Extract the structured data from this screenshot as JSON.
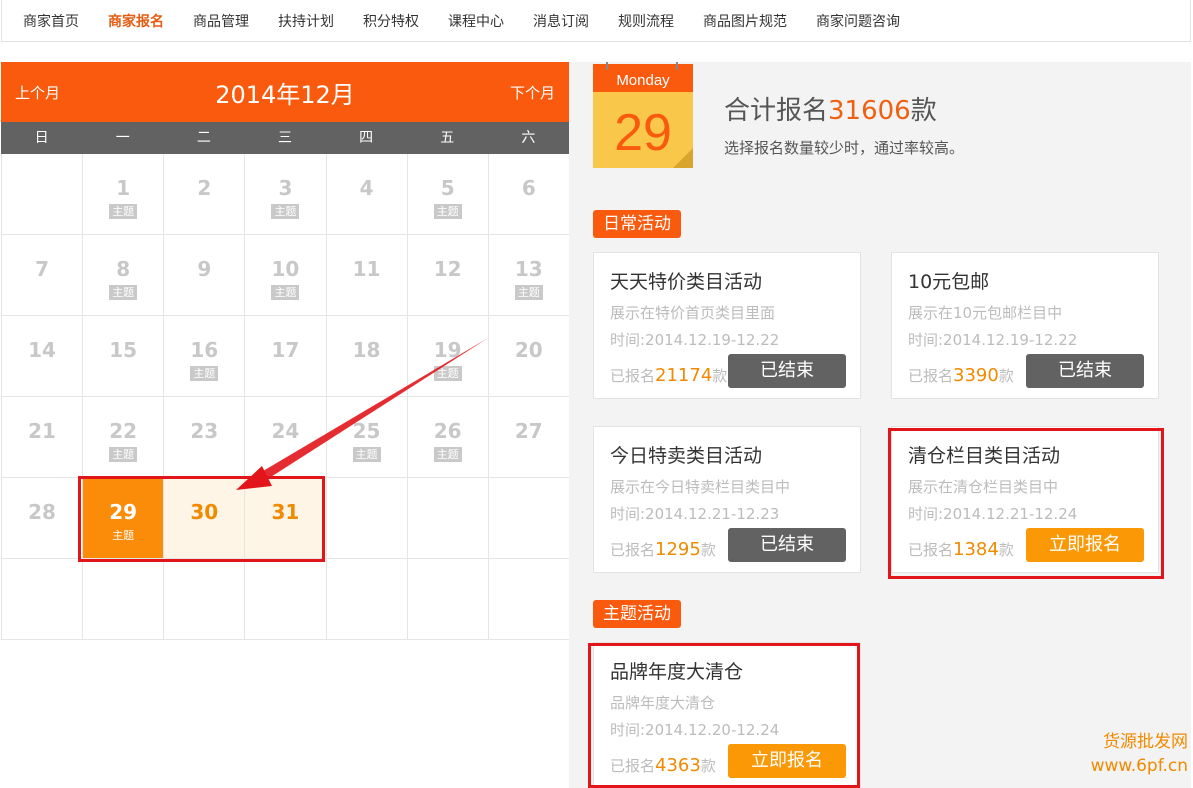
{
  "nav": [
    "商家首页",
    "商家报名",
    "商品管理",
    "扶持计划",
    "积分特权",
    "课程中心",
    "消息订阅",
    "规则流程",
    "商品图片规范",
    "商家问题咨询"
  ],
  "nav_active_index": 1,
  "calendar": {
    "prev_label": "上个月",
    "next_label": "下个月",
    "title": "2014年12月",
    "weekdays": [
      "日",
      "一",
      "二",
      "三",
      "四",
      "五",
      "六"
    ],
    "theme_label": "主题",
    "days": [
      {
        "d": ""
      },
      {
        "d": "1",
        "tag": true
      },
      {
        "d": "2"
      },
      {
        "d": "3",
        "tag": true
      },
      {
        "d": "4"
      },
      {
        "d": "5",
        "tag": true
      },
      {
        "d": "6"
      },
      {
        "d": "7"
      },
      {
        "d": "8",
        "tag": true
      },
      {
        "d": "9"
      },
      {
        "d": "10",
        "tag": true
      },
      {
        "d": "11"
      },
      {
        "d": "12"
      },
      {
        "d": "13",
        "tag": true
      },
      {
        "d": "14"
      },
      {
        "d": "15"
      },
      {
        "d": "16",
        "tag": true
      },
      {
        "d": "17"
      },
      {
        "d": "18"
      },
      {
        "d": "19",
        "tag": true
      },
      {
        "d": "20"
      },
      {
        "d": "21"
      },
      {
        "d": "22",
        "tag": true
      },
      {
        "d": "23"
      },
      {
        "d": "24"
      },
      {
        "d": "25",
        "tag": true
      },
      {
        "d": "26",
        "tag": true
      },
      {
        "d": "27"
      },
      {
        "d": "28"
      },
      {
        "d": "29",
        "tag": true,
        "state": "sel"
      },
      {
        "d": "30",
        "state": "soon"
      },
      {
        "d": "31",
        "state": "soon"
      },
      {
        "d": ""
      },
      {
        "d": ""
      },
      {
        "d": ""
      },
      {
        "d": ""
      },
      {
        "d": ""
      },
      {
        "d": ""
      },
      {
        "d": ""
      },
      {
        "d": ""
      },
      {
        "d": ""
      },
      {
        "d": ""
      }
    ]
  },
  "today_icon": {
    "weekday": "Monday",
    "day": "29"
  },
  "summary": {
    "prefix": "合计报名",
    "count": "31606",
    "suffix": "款",
    "hint": "选择报名数量较少时，通过率较高。"
  },
  "daily_section_label": "日常活动",
  "theme_section_label": "主题活动",
  "signed_prefix": "已报名",
  "signed_suffix": "款",
  "activities": [
    {
      "title": "天天特价类目活动",
      "desc": "展示在特价首页类目里面",
      "time": "时间:2014.12.19-12.22",
      "count": "21174",
      "button": "已结束",
      "status": "ended"
    },
    {
      "title": "10元包邮",
      "desc": "展示在10元包邮栏目中",
      "time": "时间:2014.12.19-12.22",
      "count": "3390",
      "button": "已结束",
      "status": "ended"
    },
    {
      "title": "今日特卖类目活动",
      "desc": "展示在今日特卖栏目类目中",
      "time": "时间:2014.12.21-12.23",
      "count": "1295",
      "button": "已结束",
      "status": "ended"
    },
    {
      "title": "清仓栏目类目活动",
      "desc": "展示在清仓栏目类目中",
      "time": "时间:2014.12.21-12.24",
      "count": "1384",
      "button": "立即报名",
      "status": "signup"
    },
    {
      "title": "品牌年度大清仓",
      "desc": "品牌年度大清仓",
      "time": "时间:2014.12.20-12.24",
      "count": "4363",
      "button": "立即报名",
      "status": "signup"
    }
  ],
  "watermark": {
    "line1": "货源批发网",
    "line2": "www.6pf.cn"
  },
  "colors": {
    "accent": "#f95a0e",
    "signup": "#fa9806",
    "ended": "#626262",
    "highlight": "#e2151b"
  }
}
